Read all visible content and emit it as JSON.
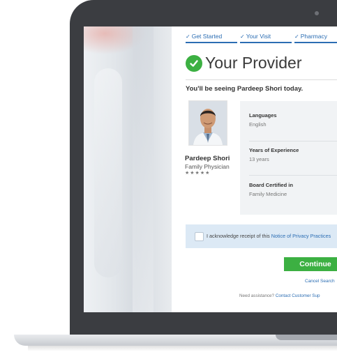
{
  "steps": [
    {
      "label": "Get Started"
    },
    {
      "label": "Your Visit"
    },
    {
      "label": "Pharmacy"
    }
  ],
  "header": {
    "title": "Your Provider"
  },
  "intro": "You'll be seeing Pardeep Shori today.",
  "provider": {
    "name": "Pardeep Shori",
    "specialty": "Family Physician",
    "rating_stars": "★★★★★",
    "rating": 5
  },
  "details": {
    "languages_label": "Languages",
    "languages_value": "English",
    "experience_label": "Years of Experience",
    "experience_value": "13 years",
    "board_label": "Board Certified in",
    "board_value": "Family Medicine"
  },
  "acknowledge": {
    "text": "I acknowledge receipt of this ",
    "link": "Notice of Privacy Practices"
  },
  "actions": {
    "continue_label": "Continue",
    "cancel_label": "Cancel Search"
  },
  "footer": {
    "assist_text": "Need assistance? ",
    "assist_link": "Contact Customer Sup"
  },
  "colors": {
    "accent_blue": "#2b6db3",
    "success_green": "#3cb042",
    "device_frame": "#3b3d41"
  }
}
